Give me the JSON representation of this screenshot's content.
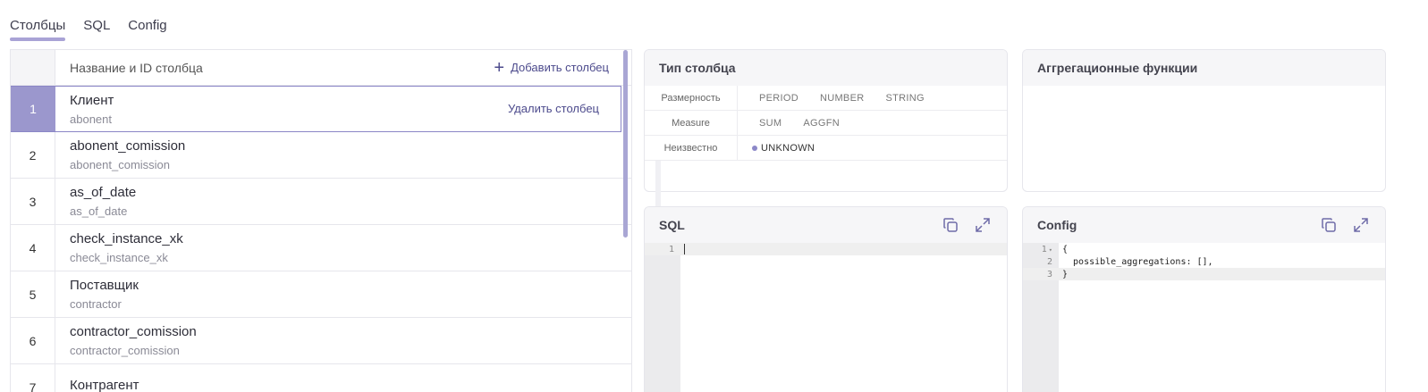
{
  "tabs": [
    {
      "label": "Столбцы",
      "active": true
    },
    {
      "label": "SQL",
      "active": false
    },
    {
      "label": "Config",
      "active": false
    }
  ],
  "columns_table": {
    "header": "Название и ID столбца",
    "add_label": "Добавить столбец",
    "delete_label": "Удалить столбец",
    "rows": [
      {
        "num": "1",
        "name": "Клиент",
        "id": "abonent",
        "selected": true
      },
      {
        "num": "2",
        "name": "abonent_comission",
        "id": "abonent_comission"
      },
      {
        "num": "3",
        "name": "as_of_date",
        "id": "as_of_date"
      },
      {
        "num": "4",
        "name": "check_instance_xk",
        "id": "check_instance_xk"
      },
      {
        "num": "5",
        "name": "Поставщик",
        "id": "contractor"
      },
      {
        "num": "6",
        "name": "contractor_comission",
        "id": "contractor_comission"
      },
      {
        "num": "7",
        "name": "Контрагент",
        "id": ""
      }
    ]
  },
  "column_type": {
    "title": "Тип столбца",
    "rows": [
      {
        "label": "Размерность",
        "options": [
          "PERIOD",
          "NUMBER",
          "STRING"
        ]
      },
      {
        "label": "Measure",
        "options": [
          "SUM",
          "AGGFN"
        ]
      },
      {
        "label": "Неизвестно",
        "options": [
          "UNKNOWN"
        ],
        "selected": "UNKNOWN"
      }
    ]
  },
  "aggregation": {
    "title": "Аггрегационные функции"
  },
  "sql_panel": {
    "title": "SQL",
    "lines": [
      {
        "n": "1",
        "code": ""
      }
    ]
  },
  "config_panel": {
    "title": "Config",
    "lines": [
      {
        "n": "1",
        "code": "{"
      },
      {
        "n": "2",
        "code": "  possible_aggregations: [],"
      },
      {
        "n": "3",
        "code": "}"
      }
    ]
  },
  "icons": {
    "add": "plus-icon",
    "copy": "copy-icon",
    "expand": "expand-icon",
    "fold": "fold-arrow-icon"
  },
  "colors": {
    "accent": "#9b97cd",
    "accent_dark": "#4c4a8c",
    "scrollbar": "#a9a6d4"
  }
}
